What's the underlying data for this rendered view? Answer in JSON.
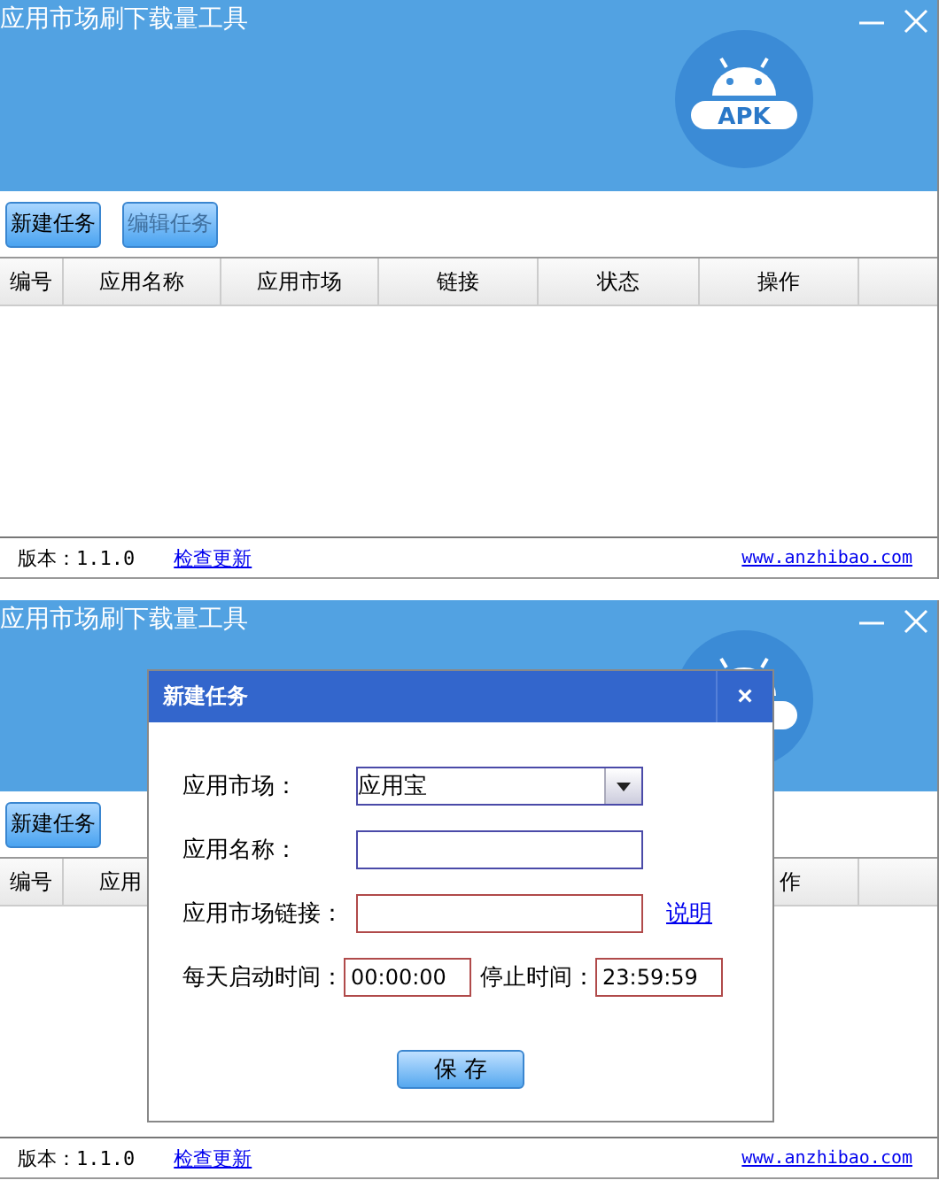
{
  "windows": [
    {
      "title": "应用市场刷下载量工具",
      "logo_text": "APK",
      "toolbar": [
        {
          "label": "新建任务",
          "disabled": false
        },
        {
          "label": "编辑任务",
          "disabled": true
        }
      ],
      "columns": [
        "编号",
        "应用名称",
        "应用市场",
        "链接",
        "状态",
        "操作"
      ],
      "footer": {
        "version": "版本：1.1.0",
        "update_link": "检查更新",
        "website": "www.anzhibao.com"
      }
    },
    {
      "title": "应用市场刷下载量工具",
      "toolbar": [
        {
          "label": "新建任务",
          "disabled": false
        }
      ],
      "columns": [
        "编号",
        "应用",
        "作"
      ],
      "footer": {
        "version": "版本：1.1.0",
        "update_link": "检查更新",
        "website": "www.anzhibao.com"
      },
      "dialog": {
        "title": "新建任务",
        "close": "×",
        "fields": [
          {
            "kind": "select",
            "label": "应用市场：",
            "value": "应用宝",
            "color": "#4a4aa8"
          },
          {
            "kind": "input",
            "label": "应用名称：",
            "color": "#4a4aa8"
          },
          {
            "kind": "input",
            "label": "应用市场链接：",
            "color": "#b04a4a",
            "link": "说明"
          }
        ],
        "times": {
          "start_label": "每天启动时间：",
          "start": "00:00:00",
          "stop_label": "停止时间：",
          "stop": "23:59:59"
        },
        "save": "保 存"
      }
    }
  ]
}
